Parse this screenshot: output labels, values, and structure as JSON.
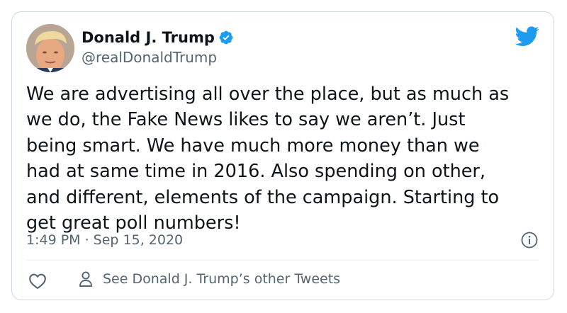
{
  "tweet": {
    "author": {
      "display_name": "Donald J. Trump",
      "handle": "@realDonaldTrump",
      "verified": true,
      "avatar_icon": "profile-photo"
    },
    "text": "We are advertising all over the place, but as much as\nwe do, the Fake News likes to say we aren’t. Just\nbeing smart. We have much more money than we\nhad at same time in 2016. Also spending on other,\nand different, elements of the campaign. Starting to\nget great poll numbers!",
    "timestamp": "1:49 PM · Sep 15, 2020",
    "actions": {
      "like_icon": "heart-icon",
      "other_tweets_label": "See Donald J. Trump’s other Tweets",
      "other_tweets_icon": "person-icon"
    },
    "icons": {
      "brand": "twitter-bird-icon",
      "verified": "verified-badge-icon",
      "info": "info-icon"
    },
    "colors": {
      "brand": "#1d9bf0",
      "text": "#0f1419",
      "secondary": "#536471",
      "border": "#cfd9de"
    }
  }
}
